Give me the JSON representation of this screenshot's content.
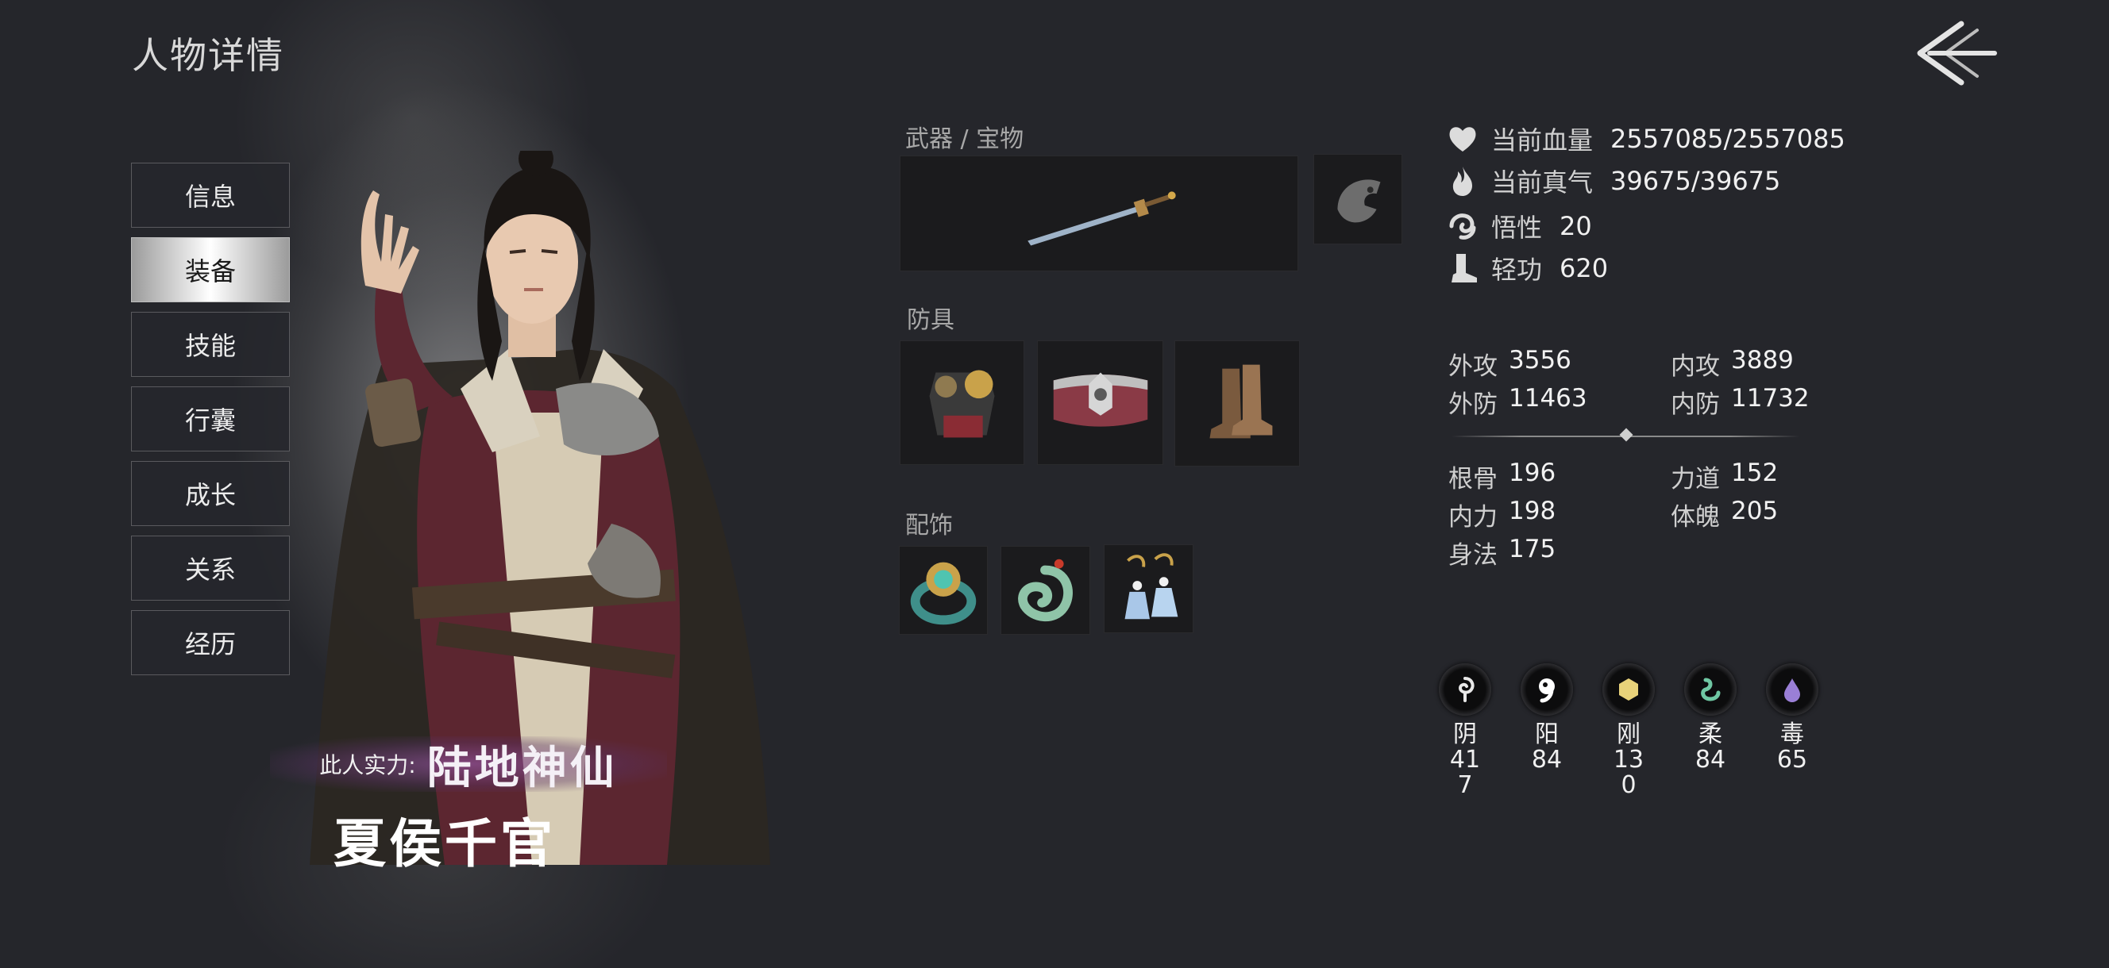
{
  "page": {
    "title": "人物详情"
  },
  "sidebar": {
    "tabs": [
      {
        "label": "信息",
        "active": false
      },
      {
        "label": "装备",
        "active": true
      },
      {
        "label": "技能",
        "active": false
      },
      {
        "label": "行囊",
        "active": false
      },
      {
        "label": "成长",
        "active": false
      },
      {
        "label": "关系",
        "active": false
      },
      {
        "label": "经历",
        "active": false
      }
    ]
  },
  "character": {
    "power_label": "此人实力:",
    "power_value": "陆地神仙",
    "name": "夏侯千官"
  },
  "equipment": {
    "weapon_label": "武器 / 宝物",
    "weapon_item": "sword-icon",
    "treasure_item": "fish-token-icon",
    "armor_label": "防具",
    "armor_items": [
      "chest-armor-icon",
      "belt-icon",
      "boots-icon"
    ],
    "accessory_label": "配饰",
    "accessory_items": [
      "jade-ring-icon",
      "jade-dragon-pendant-icon",
      "earrings-icon"
    ]
  },
  "vitals": [
    {
      "icon": "heart-icon",
      "label": "当前血量",
      "value": "2557085/2557085"
    },
    {
      "icon": "flame-icon",
      "label": "当前真气",
      "value": "39675/39675"
    },
    {
      "icon": "swirl-icon",
      "label": "悟性",
      "value": "20"
    },
    {
      "icon": "boot-icon",
      "label": "轻功",
      "value": "620"
    }
  ],
  "combat": {
    "outer_attack": {
      "label": "外攻",
      "value": "3556"
    },
    "inner_attack": {
      "label": "内攻",
      "value": "3889"
    },
    "outer_defense": {
      "label": "外防",
      "value": "11463"
    },
    "inner_defense": {
      "label": "内防",
      "value": "11732"
    }
  },
  "attributes": {
    "bone": {
      "label": "根骨",
      "value": "196"
    },
    "strength": {
      "label": "力道",
      "value": "152"
    },
    "inner_power": {
      "label": "内力",
      "value": "198"
    },
    "physique": {
      "label": "体魄",
      "value": "205"
    },
    "agility": {
      "label": "身法",
      "value": "175"
    }
  },
  "elements": [
    {
      "icon": "yin-icon",
      "name": "阴",
      "value": "417",
      "color": "#e8e8e8"
    },
    {
      "icon": "yang-icon",
      "name": "阳",
      "value": "84",
      "color": "#ffffff"
    },
    {
      "icon": "hard-icon",
      "name": "刚",
      "value": "130",
      "color": "#e8d27a"
    },
    {
      "icon": "soft-icon",
      "name": "柔",
      "value": "84",
      "color": "#6fc7a3"
    },
    {
      "icon": "poison-icon",
      "name": "毒",
      "value": "65",
      "color": "#9a7fd6"
    }
  ],
  "colors": {
    "background": "#25262b",
    "slot": "#1b1b1d",
    "active_tab": "#ffffff"
  }
}
